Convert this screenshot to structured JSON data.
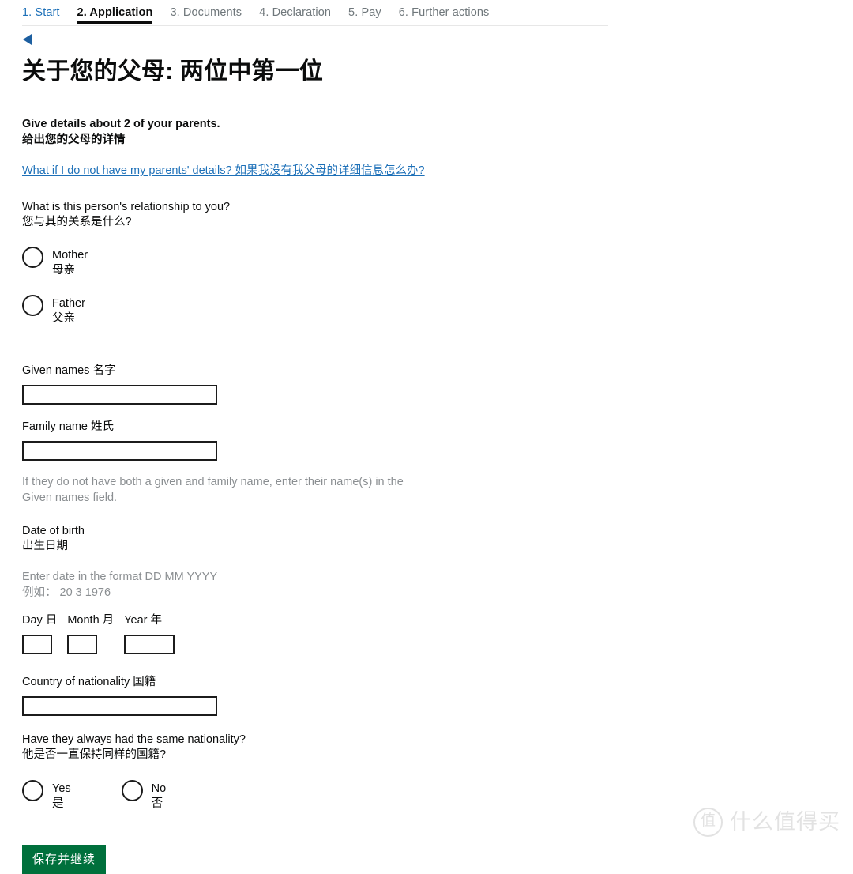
{
  "tabs": [
    {
      "label": "1. Start",
      "state": "link"
    },
    {
      "label": "2. Application",
      "state": "current"
    },
    {
      "label": "3. Documents",
      "state": "muted"
    },
    {
      "label": "4. Declaration",
      "state": "muted"
    },
    {
      "label": "5. Pay",
      "state": "muted"
    },
    {
      "label": "6. Further actions",
      "state": "muted"
    }
  ],
  "nav": {
    "back_icon": "back-triangle-icon"
  },
  "page": {
    "title": "关于您的父母: 两位中第一位",
    "lead_en": "Give details about 2 of your parents.",
    "lead_zh": "给出您的父母的详情",
    "help_link": "What if I do not have my parents' details? 如果我没有我父母的详细信息怎么办?"
  },
  "relationship": {
    "question_en": "What is this person's relationship to you?",
    "question_zh": "您与其的关系是什么?",
    "options": [
      {
        "en": "Mother",
        "zh": "母亲",
        "selected": false
      },
      {
        "en": "Father",
        "zh": "父亲",
        "selected": false
      }
    ]
  },
  "names": {
    "given_label": "Given names 名字",
    "given_value": "",
    "family_label": "Family name 姓氏",
    "family_value": "",
    "hint": "If they do not have both a given and family name, enter their name(s) in the Given names field."
  },
  "dob": {
    "label_en": "Date of birth",
    "label_zh": "出生日期",
    "hint_en": "Enter date in the format DD MM YYYY",
    "hint_zh": "例如：  20 3 1976",
    "day_label": "Day 日",
    "day_value": "",
    "month_label": "Month 月",
    "month_value": "",
    "year_label": "Year 年",
    "year_value": ""
  },
  "nationality": {
    "country_label": "Country of nationality 国籍",
    "country_value": "",
    "question_en": "Have they always had the same nationality?",
    "question_zh": "他是否一直保持同样的国籍?",
    "options": [
      {
        "en": "Yes",
        "zh": "是",
        "selected": false
      },
      {
        "en": "No",
        "zh": "否",
        "selected": false
      }
    ]
  },
  "actions": {
    "save_label": "保存并继续"
  },
  "watermark": {
    "badge": "值",
    "text": "什么值得买"
  },
  "colors": {
    "link_blue": "#1d70b8",
    "muted_gray": "#6f777b",
    "hint_gray": "#8b8f92",
    "button_green": "#00703c",
    "button_shadow": "#002d18",
    "text_black": "#0b0c0c",
    "watermark_gray": "#e2e2e2"
  }
}
